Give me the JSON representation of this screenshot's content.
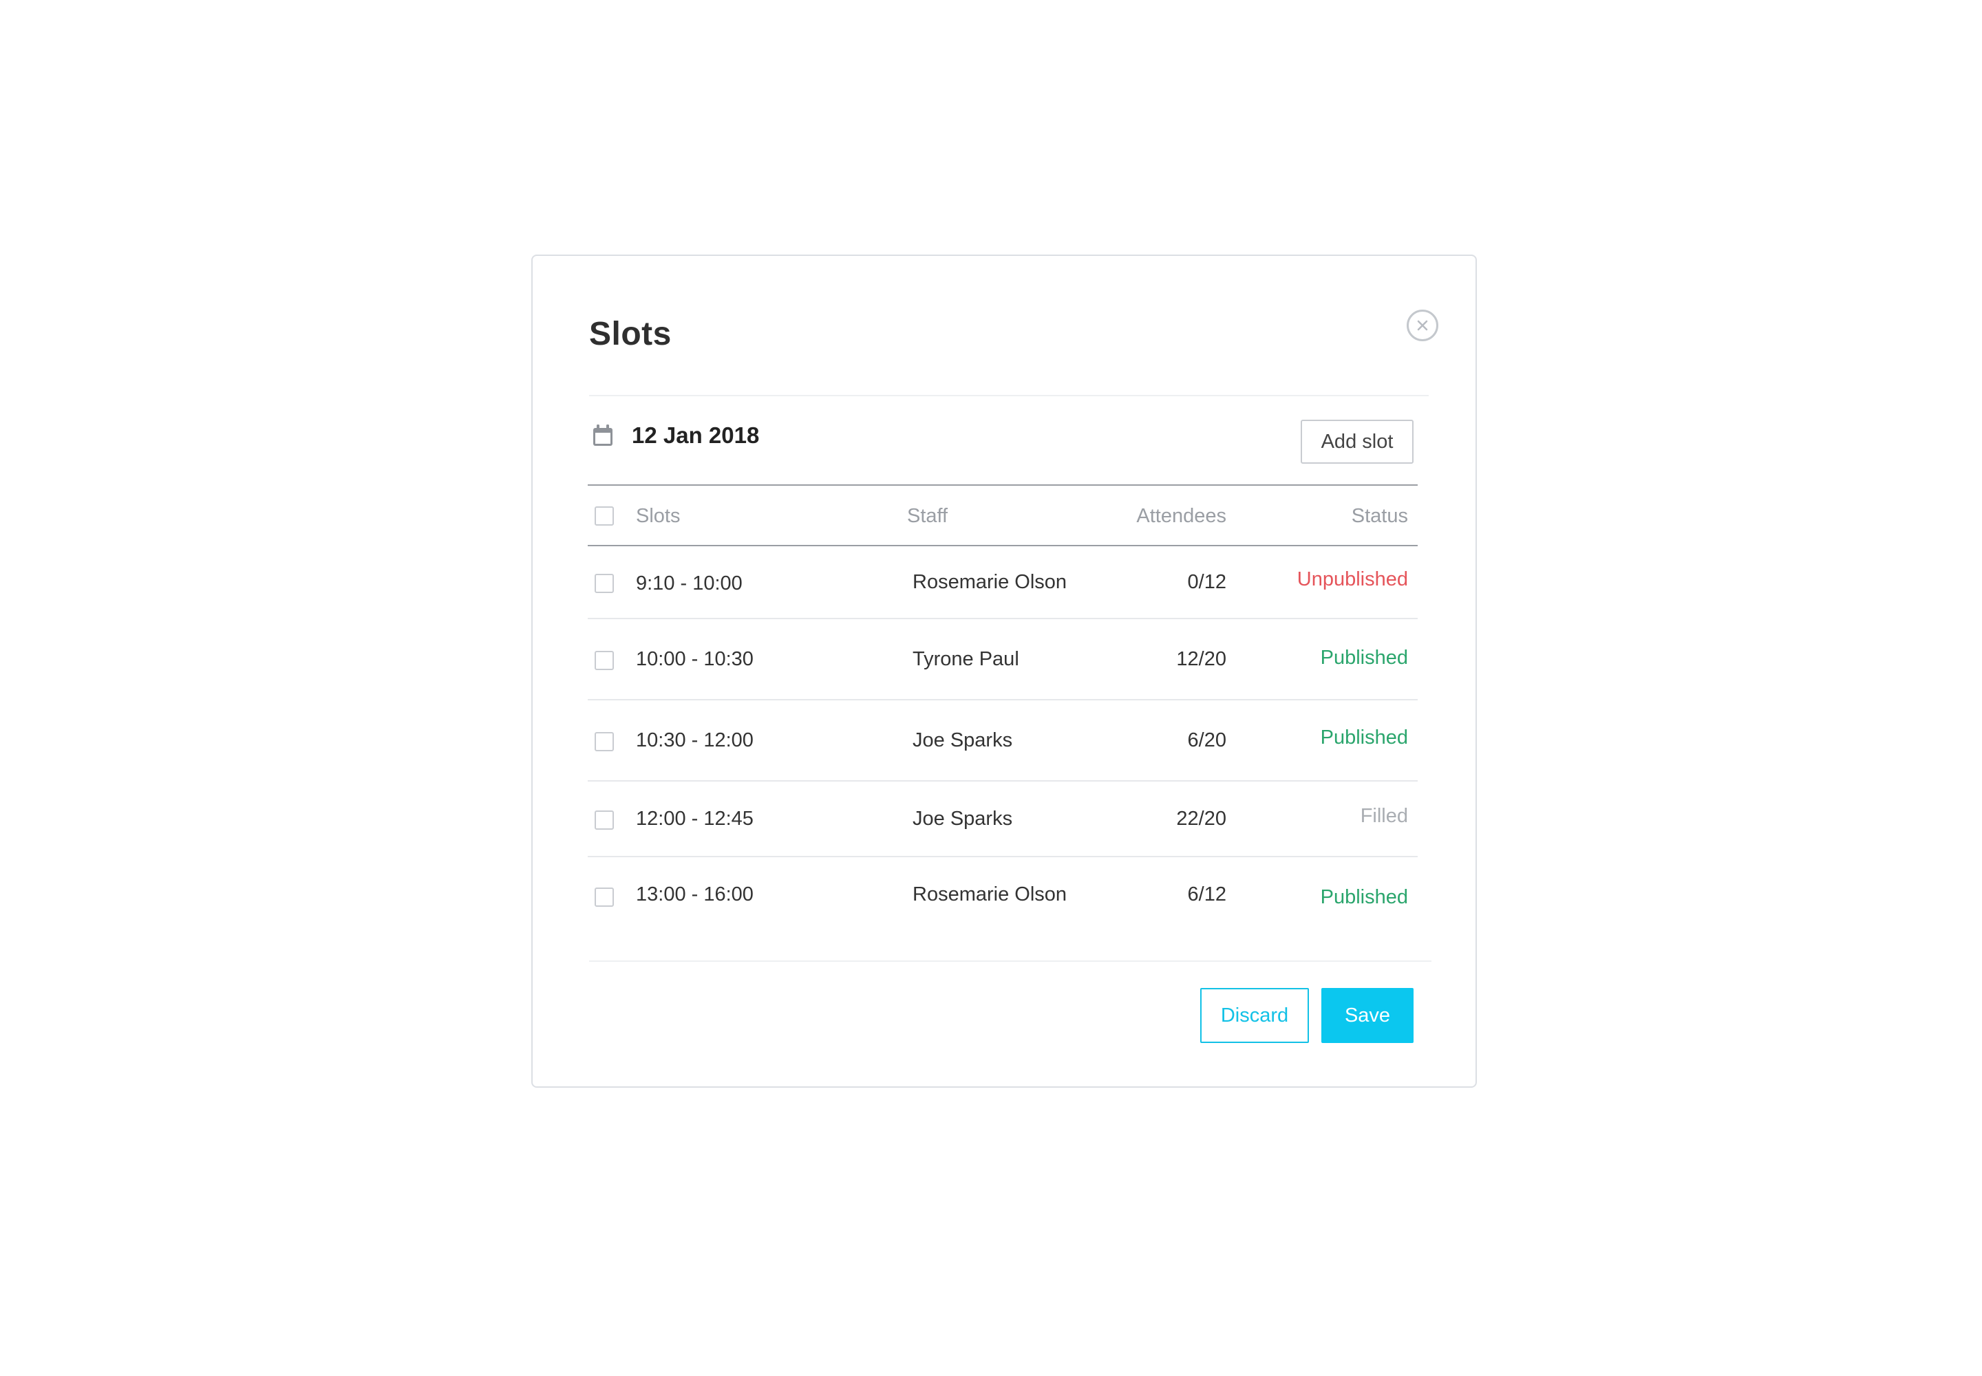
{
  "modal": {
    "title": "Slots",
    "date": "12 Jan 2018",
    "add_slot_label": "Add slot",
    "discard_label": "Discard",
    "save_label": "Save"
  },
  "icons": {
    "close": "close-icon",
    "calendar": "calendar-icon"
  },
  "table": {
    "headers": {
      "slots": "Slots",
      "staff": "Staff",
      "attendees": "Attendees",
      "status": "Status"
    },
    "rows": [
      {
        "time": "9:10 - 10:00",
        "staff": "Rosemarie Olson",
        "attendees": "0/12",
        "status": "Unpublished"
      },
      {
        "time": "10:00 - 10:30",
        "staff": "Tyrone Paul",
        "attendees": "12/20",
        "status": "Published"
      },
      {
        "time": "10:30 - 12:00",
        "staff": "Joe Sparks",
        "attendees": "6/20",
        "status": "Published"
      },
      {
        "time": "12:00 - 12:45",
        "staff": "Joe Sparks",
        "attendees": "22/20",
        "status": "Filled"
      },
      {
        "time": "13:00 - 16:00",
        "staff": "Rosemarie Olson",
        "attendees": "6/12",
        "status": "Published"
      }
    ]
  },
  "colors": {
    "accent": "#0bc7ef",
    "published": "#2aa56c",
    "unpublished": "#e5545a",
    "filled": "#a9adb2"
  }
}
